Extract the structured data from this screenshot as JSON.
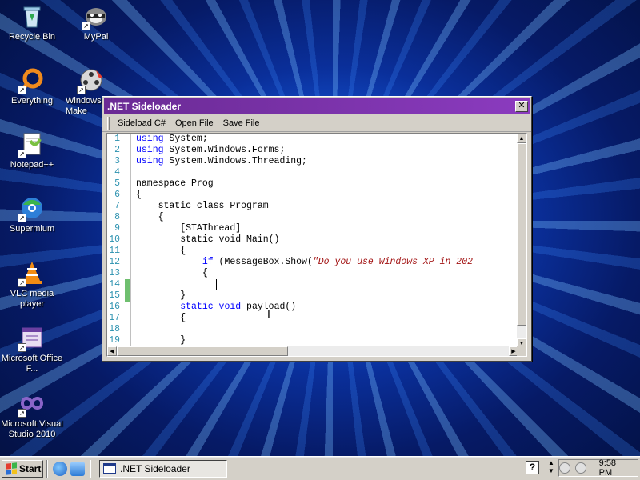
{
  "desktop": {
    "icons": [
      {
        "label": "Recycle Bin"
      },
      {
        "label": "MyPal"
      },
      {
        "label": "Everything"
      },
      {
        "label": "Windows Make"
      },
      {
        "label": "Notepad++"
      },
      {
        "label": "Supermium"
      },
      {
        "label": "VLC media player"
      },
      {
        "label": "Microsoft Office F..."
      },
      {
        "label": "Microsoft Visual Studio 2010"
      }
    ]
  },
  "window": {
    "title": ".NET Sideloader",
    "close_glyph": "✕",
    "menu": [
      "Sideload C#",
      "Open File",
      "Save File"
    ],
    "code_lines": [
      {
        "n": "1",
        "parts": [
          {
            "t": "using",
            "c": "kw"
          },
          {
            "t": " System;"
          }
        ]
      },
      {
        "n": "2",
        "parts": [
          {
            "t": "using",
            "c": "kw"
          },
          {
            "t": " System.Windows.Forms;"
          }
        ]
      },
      {
        "n": "3",
        "parts": [
          {
            "t": "using",
            "c": "kw"
          },
          {
            "t": " System.Windows.Threading;"
          }
        ]
      },
      {
        "n": "4",
        "parts": [
          {
            "t": ""
          }
        ]
      },
      {
        "n": "5",
        "parts": [
          {
            "t": "namespace Prog"
          }
        ]
      },
      {
        "n": "6",
        "parts": [
          {
            "t": "{"
          }
        ]
      },
      {
        "n": "7",
        "parts": [
          {
            "t": "    static class Program"
          }
        ]
      },
      {
        "n": "8",
        "parts": [
          {
            "t": "    {"
          }
        ]
      },
      {
        "n": "9",
        "parts": [
          {
            "t": "        [STAThread]"
          }
        ]
      },
      {
        "n": "10",
        "parts": [
          {
            "t": "        static void Main()"
          }
        ]
      },
      {
        "n": "11",
        "parts": [
          {
            "t": "        {"
          }
        ]
      },
      {
        "n": "12",
        "parts": [
          {
            "t": "            "
          },
          {
            "t": "if",
            "c": "kw"
          },
          {
            "t": " (MessageBox.Show("
          },
          {
            "t": "\"Do you use Windows XP in 202",
            "c": "str"
          }
        ]
      },
      {
        "n": "13",
        "parts": [
          {
            "t": "            {"
          }
        ]
      },
      {
        "n": "14",
        "parts": [
          {
            "t": ""
          }
        ],
        "changed": true
      },
      {
        "n": "15",
        "parts": [
          {
            "t": "        }"
          }
        ],
        "changed": true
      },
      {
        "n": "16",
        "parts": [
          {
            "t": "        "
          },
          {
            "t": "static",
            "c": "kw"
          },
          {
            "t": " "
          },
          {
            "t": "void",
            "c": "kw"
          },
          {
            "t": " payload()"
          }
        ]
      },
      {
        "n": "17",
        "parts": [
          {
            "t": "        {"
          }
        ]
      },
      {
        "n": "18",
        "parts": [
          {
            "t": ""
          }
        ]
      },
      {
        "n": "19",
        "parts": [
          {
            "t": "        }"
          }
        ]
      }
    ],
    "text_cursor_glyph": "I"
  },
  "taskbar": {
    "start_label": "Start",
    "active_task": ".NET Sideloader",
    "help_glyph": "?",
    "clock": "9:58 PM"
  }
}
